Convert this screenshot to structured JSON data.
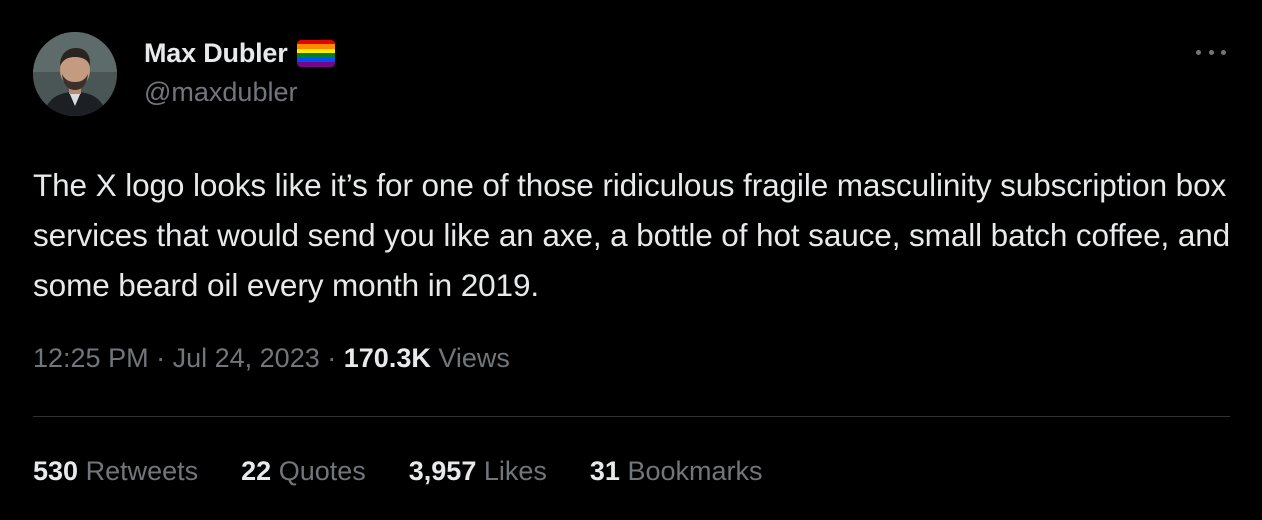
{
  "author": {
    "display_name": "Max Dubler",
    "handle": "@maxdubler",
    "flag_colors": [
      "#e40303",
      "#ff8c00",
      "#ffed00",
      "#008026",
      "#004dff",
      "#750787"
    ]
  },
  "tweet": {
    "text": "The X logo looks like it’s for one of those ridiculous fragile masculinity subscription box services that would send you like an axe, a bottle of hot sauce, small batch coffee, and some beard oil every month in 2019.",
    "time": "12:25 PM",
    "separator": "·",
    "date": "Jul 24, 2023",
    "views_count": "170.3K",
    "views_label": "Views"
  },
  "stats": [
    {
      "count": "530",
      "label": "Retweets"
    },
    {
      "count": "22",
      "label": "Quotes"
    },
    {
      "count": "3,957",
      "label": "Likes"
    },
    {
      "count": "31",
      "label": "Bookmarks"
    }
  ],
  "icons": {
    "more": "more-horizontal-icon",
    "flag": "rainbow-flag-emoji"
  },
  "colors": {
    "background": "#000000",
    "primary_text": "#e7e9ea",
    "secondary_text": "#71767b",
    "divider": "#2f3336"
  }
}
